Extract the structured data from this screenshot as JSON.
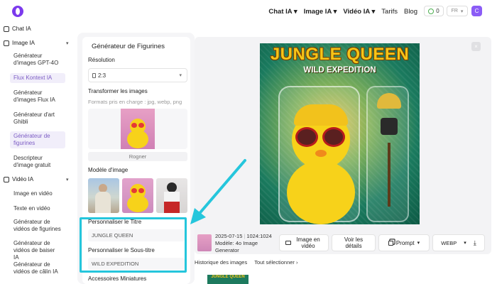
{
  "topnav": {
    "items": [
      {
        "label": "Chat IA",
        "dropdown": true
      },
      {
        "label": "Image IA",
        "dropdown": true
      },
      {
        "label": "Vidéo IA",
        "dropdown": true
      },
      {
        "label": "Tarifs",
        "dropdown": false
      },
      {
        "label": "Blog",
        "dropdown": false
      }
    ],
    "credits": "0",
    "language": "FR",
    "avatar_letter": "C"
  },
  "sidebar": {
    "chat_section": "Chat IA",
    "image_section": "Image IA",
    "image_items": [
      {
        "label": "Générateur d'images GPT-4O",
        "active": false
      },
      {
        "label": "Flux Kontext IA",
        "active": true
      },
      {
        "label": "Générateur d'images Flux IA",
        "active": false
      },
      {
        "label": "Générateur d'art Ghibli",
        "active": false
      },
      {
        "label": "Générateur de figurines",
        "active": true
      },
      {
        "label": "Descripteur d'image gratuit",
        "active": false
      }
    ],
    "video_section": "Vidéo IA",
    "video_items": [
      {
        "label": "Image en vidéo"
      },
      {
        "label": "Texte en vidéo"
      },
      {
        "label": "Générateur de vidéos de figurines"
      },
      {
        "label": "Générateur de vidéos de baiser IA"
      },
      {
        "label": "Générateur de vidéos de câlin IA"
      }
    ]
  },
  "panel": {
    "title": "Générateur de Figurines",
    "resolution_label": "Résolution",
    "resolution_value": "2:3",
    "transform_label": "Transformer les images",
    "formats_hint": "Formats pris en charge : jpg, webp, png",
    "crop_label": "Rogner",
    "model_label": "Modèle d'image",
    "title_label": "Personnaliser le Titre",
    "title_value": "JUNGLE QUEEN",
    "subtitle_label": "Personnaliser le Sous-titre",
    "subtitle_value": "WILD EXPEDITION",
    "accessories_label": "Accessoires Miniatures"
  },
  "preview": {
    "poster_title": "JUNGLE QUEEN",
    "poster_subtitle": "WILD EXPEDITION",
    "close_icon": "×"
  },
  "info": {
    "date": "2025-07-15",
    "size": "1024:1024",
    "model": "Modèle: 4o Image Generator",
    "btn_video": "Image en vidéo",
    "btn_details": "Voir les détails",
    "btn_prompt": "Prompt",
    "btn_format": "WEBP",
    "history_label": "Historique des images",
    "select_all": "Tout sélectionner"
  },
  "icons": {
    "logo": "brand-logo-icon",
    "download": "download-icon",
    "chevron": "chevron-down-icon"
  },
  "colors": {
    "accent": "#7c3aed",
    "highlight": "#25c6dc",
    "poster_green": "#1a7a5e",
    "poster_yellow": "#f5c518"
  }
}
